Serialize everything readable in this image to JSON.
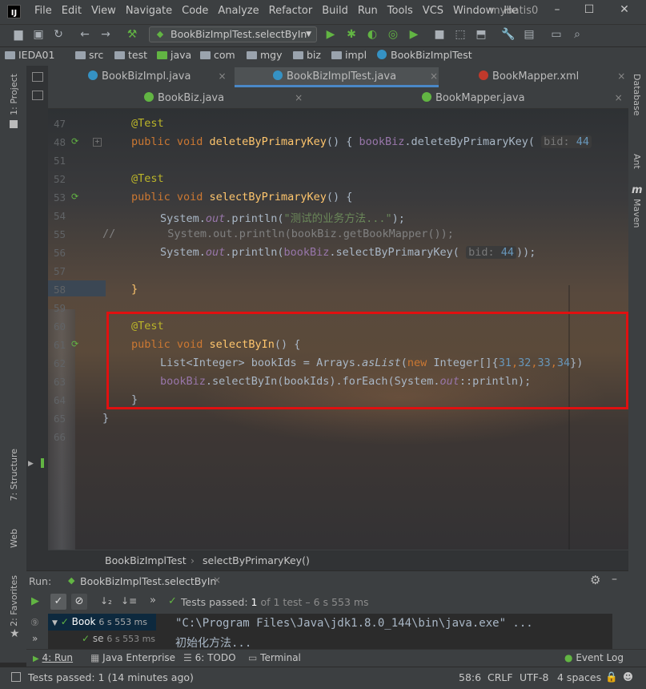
{
  "window": {
    "app_title": "mybatis0",
    "logo_text": "IJ",
    "controls": {
      "minimize": "–",
      "maximize": "☐",
      "close": "✕"
    }
  },
  "menu": [
    "File",
    "Edit",
    "View",
    "Navigate",
    "Code",
    "Analyze",
    "Refactor",
    "Build",
    "Run",
    "Tools",
    "VCS",
    "Window",
    "He"
  ],
  "toolbar": {
    "run_config": "BookBizImplTest.selectByIn",
    "icons": [
      "open-icon",
      "save-icon",
      "sync-icon",
      "back-icon",
      "forward-icon",
      "build-icon",
      "run-icon",
      "debug-icon",
      "coverage-icon",
      "profile-icon",
      "stop-icon",
      "search-icon"
    ]
  },
  "navbar": {
    "crumbs": [
      "IEDA01",
      "src",
      "test",
      "java",
      "com",
      "mgy",
      "biz",
      "impl",
      "BookBizImplTest"
    ]
  },
  "left_strip": {
    "project": "1: Project",
    "structure": "7: Structure",
    "web": "Web",
    "favorites": "2: Favorites"
  },
  "right_strip": {
    "database": "Database",
    "ant": "Ant",
    "maven": "Maven",
    "maven_glyph": "m"
  },
  "tabs_row1": [
    {
      "label": "BookBizImpl.java",
      "active": false
    },
    {
      "label": "BookBizImplTest.java",
      "active": true
    },
    {
      "label": "BookMapper.xml",
      "active": false
    }
  ],
  "tabs_row2": [
    {
      "label": "BookBiz.java"
    },
    {
      "label": "BookMapper.java"
    }
  ],
  "tab_close": "×",
  "editor": {
    "lines": [
      {
        "n": "47"
      },
      {
        "n": "48"
      },
      {
        "n": "51"
      },
      {
        "n": "52"
      },
      {
        "n": "53"
      },
      {
        "n": "54"
      },
      {
        "n": "55"
      },
      {
        "n": "56"
      },
      {
        "n": "57"
      },
      {
        "n": "58"
      },
      {
        "n": "59"
      },
      {
        "n": "60"
      },
      {
        "n": "61"
      },
      {
        "n": "62"
      },
      {
        "n": "63"
      },
      {
        "n": "64"
      },
      {
        "n": "65"
      },
      {
        "n": "66"
      }
    ],
    "tokens": {
      "test_ann": "@Test",
      "public_void": "public void",
      "m_delete": "deleteByPrimaryKey",
      "sig_open": "() {",
      "bookBiz": "bookBiz",
      "call_delete": ".deleteByPrimaryKey(",
      "hint_bid": "bid:",
      "bid_val": "44",
      "m_select": "selectByPrimaryKey",
      "brace_open": "{",
      "system": "System.",
      "out": "out",
      "println_open": ".println(",
      "str_test": "\"测试的业务方法...\"",
      "close_semi": ");",
      "comment_slash": "//",
      "comment_body": "        System.out.println(bookBiz.getBookMapper());",
      "call_select": ".selectByPrimaryKey(",
      "close2": "));",
      "brace_close": "}",
      "m_selectIn": "selectByIn",
      "list_decl": "List<Integer> bookIds = Arrays.",
      "as_list": "asList",
      "paren_open": "(",
      "new_kw": "new",
      "integer_arr": " Integer[]{",
      "n31": "31",
      "n32": "32",
      "n33": "33",
      "n34": "34",
      "comma": ",",
      "close_arr": "})",
      "call_selectIn": ".selectByIn(bookIds).forEach(System.",
      "method_ref": "::println);"
    },
    "breadcrumb": [
      "BookBizImplTest",
      "selectByPrimaryKey()"
    ]
  },
  "run_panel": {
    "label": "Run:",
    "config": "BookBizImplTest.selectByIn",
    "status_prefix": "Tests passed:",
    "status_count": "1",
    "status_rest": "of 1 test – 6 s 553 ms",
    "tree": [
      {
        "label": "Book",
        "time": "6 s 553 ms"
      },
      {
        "label": "se",
        "time": "6 s 553 ms"
      }
    ],
    "console": [
      "\"C:\\Program Files\\Java\\jdk1.8.0_144\\bin\\java.exe\" ...",
      "初始化方法..."
    ],
    "icons": {
      "settings": "⚙",
      "minimize": "–",
      "check": "✓",
      "stop": "⊘",
      "sort_az": "↓₂",
      "sort_dur": "↓≡",
      "chevron": "»"
    }
  },
  "bottom_tabs": [
    {
      "label": "4: Run"
    },
    {
      "label": "Java Enterprise"
    },
    {
      "label": "6: TODO"
    },
    {
      "label": "Terminal"
    },
    {
      "label": "Event Log"
    }
  ],
  "status": {
    "message": "Tests passed: 1 (14 minutes ago)",
    "position": "58:6",
    "line_sep": "CRLF",
    "encoding": "UTF-8",
    "indent": "4 spaces"
  },
  "colors": {
    "keyword": "#cc7832",
    "function": "#ffc66d",
    "annotation": "#bbb529",
    "field": "#9876aa",
    "string": "#6a8759",
    "number": "#6897bb",
    "highlight_box": "#e01010",
    "pass_green": "#62b543"
  }
}
